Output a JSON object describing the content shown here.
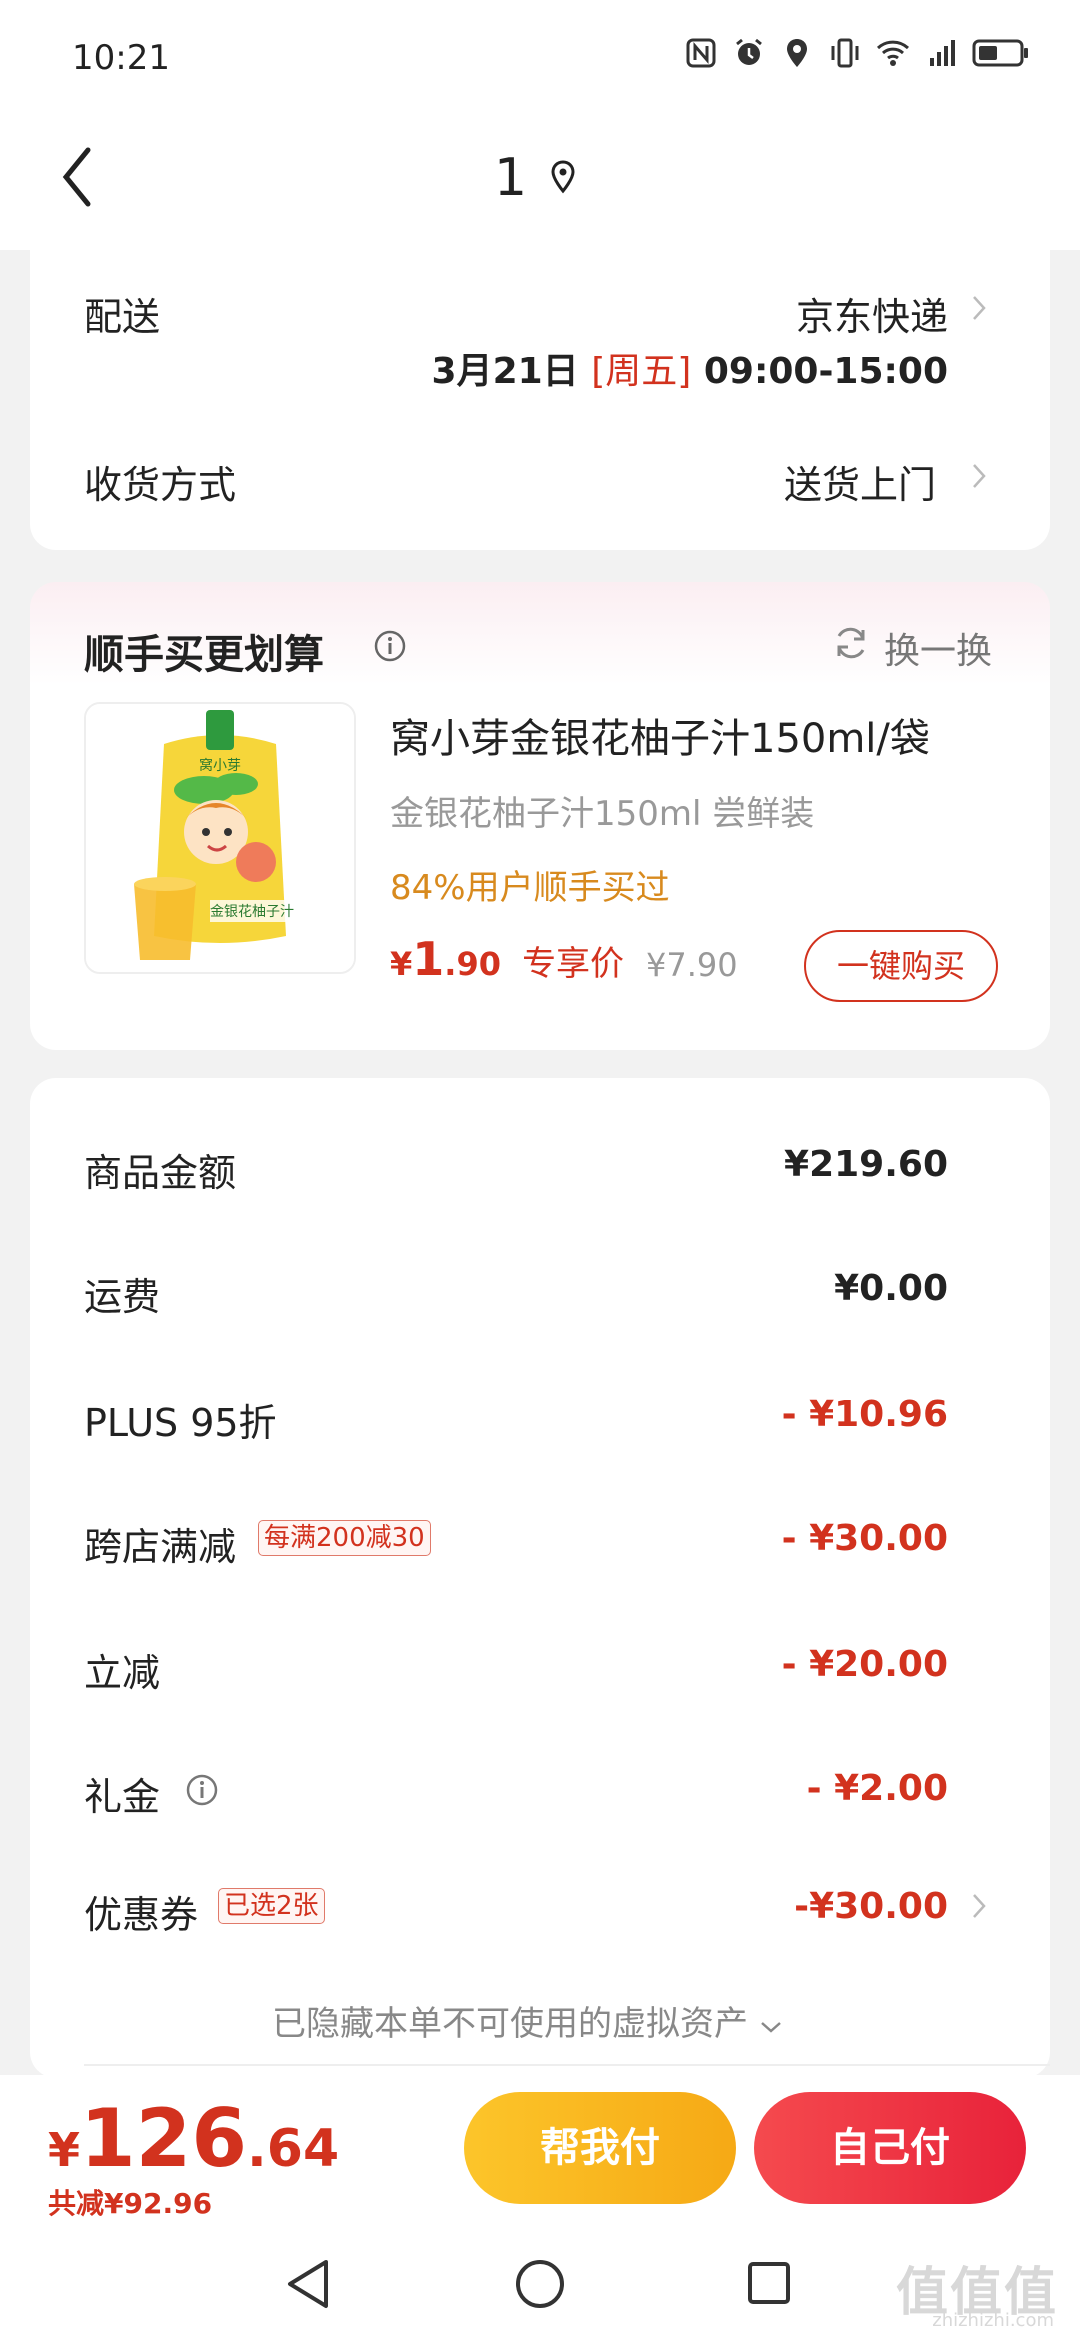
{
  "status": {
    "time": "10:21"
  },
  "nav": {
    "title": "1"
  },
  "delivery": {
    "label": "配送",
    "carrier": "京东快递",
    "date": "3月21日",
    "weekday": "[周五]",
    "time_range": "09:00-15:00",
    "receive_label": "收货方式",
    "receive_value": "送货上门"
  },
  "addon": {
    "title": "顺手买更划算",
    "refresh_label": "换一换",
    "product_name": "窝小芽金银花柚子汁150ml/袋",
    "subtitle": "金银花柚子汁150ml 尝鲜装",
    "buyers": "84%用户顺手买过",
    "price_symbol": "¥",
    "price_int": "1",
    "price_dec": ".90",
    "price_tag": "专享价",
    "original_price": "¥7.90",
    "buy_button": "一键购买",
    "image_brand": "窝小芽",
    "image_label": "金银花柚子汁"
  },
  "summary": {
    "rows": [
      {
        "label": "商品金额",
        "value": "¥219.60"
      },
      {
        "label": "运费",
        "value": "¥0.00"
      },
      {
        "label": "PLUS 95折",
        "value": "- ¥10.96"
      },
      {
        "label": "跨店满减",
        "tag": "每满200减30",
        "value": "- ¥30.00"
      },
      {
        "label": "立减",
        "value": "- ¥20.00"
      },
      {
        "label": "礼金",
        "value": "- ¥2.00"
      },
      {
        "label": "优惠券",
        "tag": "已选2张",
        "value": "-¥30.00"
      }
    ],
    "hidden_note": "已隐藏本单不可使用的虚拟资产"
  },
  "footer": {
    "currency": "¥",
    "total_int": "126",
    "total_dec": ".64",
    "saved": "共减¥92.96",
    "help_pay": "帮我付",
    "self_pay": "自己付"
  },
  "watermark": {
    "main": "值值值",
    "sub": "zhizhizhi.com"
  },
  "colors": {
    "accent_red": "#d2321e",
    "help_yellow": "#f6a915",
    "pay_red": "#e8223a"
  }
}
